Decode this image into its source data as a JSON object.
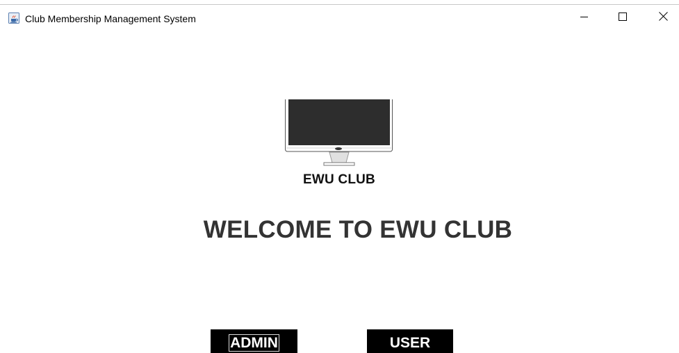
{
  "window": {
    "title": "Club Membership Management System",
    "icons": {
      "app": "java-cup-icon",
      "minimize": "minimize-icon",
      "maximize": "maximize-icon",
      "close": "close-icon"
    }
  },
  "main": {
    "logo_icon": "monitor-icon",
    "logo_text": "EWU CLUB",
    "welcome_heading": "WELCOME TO EWU CLUB",
    "buttons": {
      "admin_label": "ADMIN",
      "user_label": "USER"
    }
  },
  "colors": {
    "button_bg": "#000000",
    "button_text": "#ffffff",
    "heading": "#333333",
    "monitor_screen": "#2d2d2d"
  }
}
